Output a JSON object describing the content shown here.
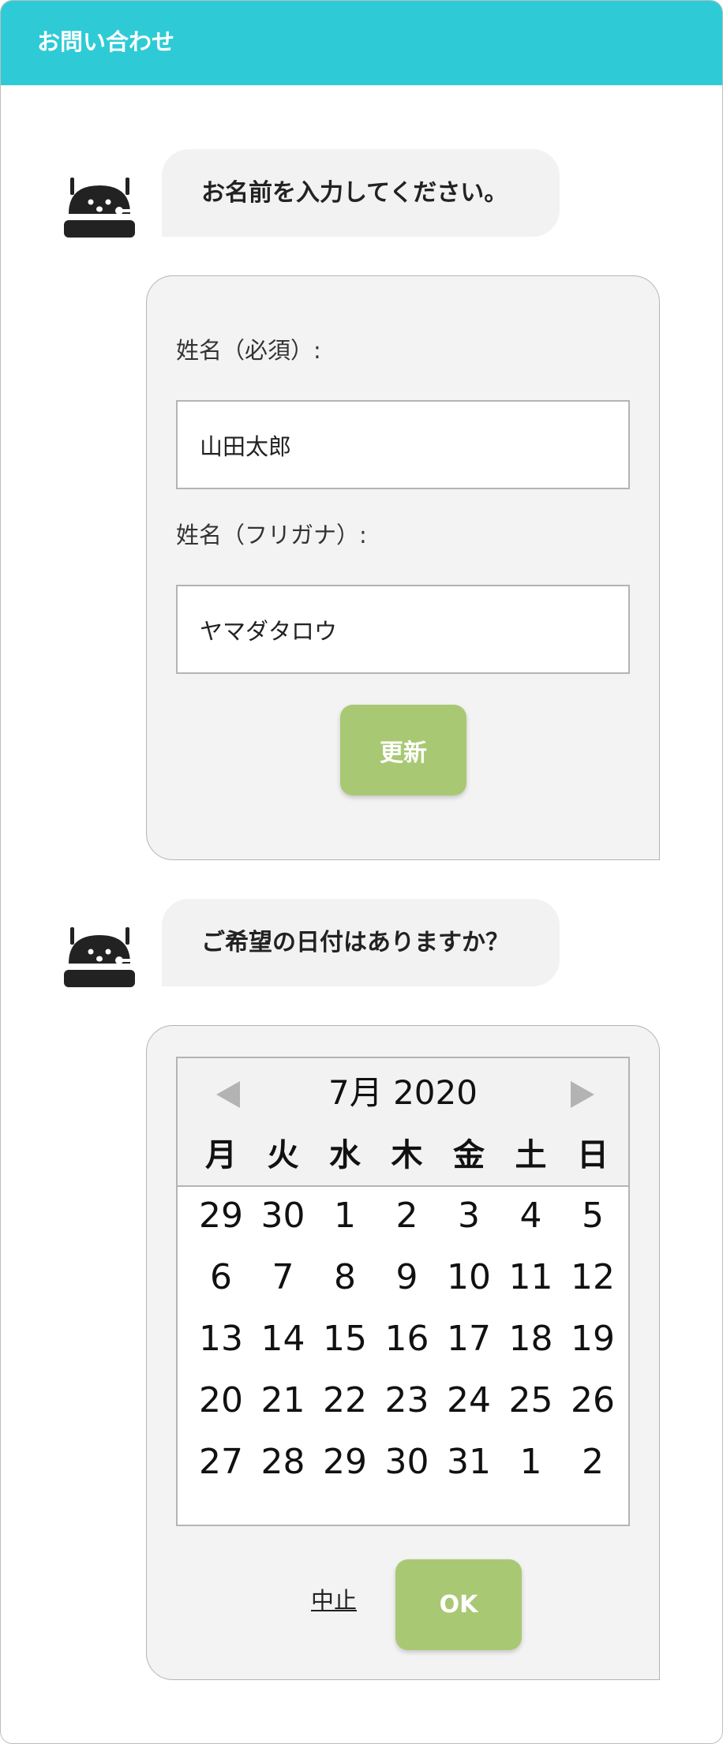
{
  "header": {
    "title": "お問い合わせ"
  },
  "bot": {
    "avatar_icon": "robot-icon"
  },
  "name_step": {
    "prompt": "お名前を入力してください。",
    "name_label": "姓名（必須）:",
    "name_value": "山田太郎",
    "kana_label": "姓名（フリガナ）:",
    "kana_value": "ヤマダタロウ",
    "update_button": "更新"
  },
  "date_step": {
    "prompt": "ご希望の日付はありますか？",
    "calendar": {
      "month_label": "7月 2020",
      "prev_icon": "triangle-left-icon",
      "next_icon": "triangle-right-icon",
      "weekdays": [
        "月",
        "火",
        "水",
        "木",
        "金",
        "土",
        "日"
      ],
      "weeks": [
        [
          "29",
          "30",
          "1",
          "2",
          "3",
          "4",
          "5"
        ],
        [
          "6",
          "7",
          "8",
          "9",
          "10",
          "11",
          "12"
        ],
        [
          "13",
          "14",
          "15",
          "16",
          "17",
          "18",
          "19"
        ],
        [
          "20",
          "21",
          "22",
          "23",
          "24",
          "25",
          "26"
        ],
        [
          "27",
          "28",
          "29",
          "30",
          "31",
          "1",
          "2"
        ]
      ]
    },
    "cancel_link": "中止",
    "ok_button": "OK"
  },
  "colors": {
    "header": "#2ecbd6",
    "button": "#a9c874",
    "panel": "#f3f3f3",
    "bubble": "#f2f2f2"
  }
}
